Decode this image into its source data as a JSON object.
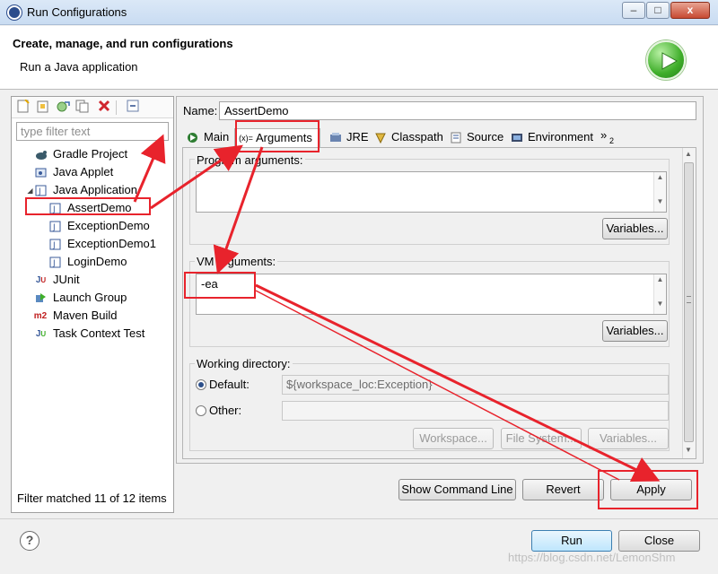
{
  "window": {
    "title": "Run Configurations",
    "controls": {
      "minimize": "–",
      "maximize": "□",
      "close": "x"
    }
  },
  "header": {
    "title": "Create, manage, and run configurations",
    "subtitle": "Run a Java application"
  },
  "left": {
    "toolbar": [
      "new-config-icon",
      "new-prototype-icon",
      "export-icon",
      "duplicate-icon",
      "delete-icon",
      "collapse-all-icon"
    ],
    "filter_placeholder": "type filter text",
    "tree": [
      {
        "label": "Gradle Project",
        "icon": "gradle-icon",
        "level": 0
      },
      {
        "label": "Java Applet",
        "icon": "applet-icon",
        "level": 0
      },
      {
        "label": "Java Application",
        "icon": "java-app-icon",
        "level": 0,
        "expanded": true
      },
      {
        "label": "AssertDemo",
        "icon": "java-class-icon",
        "level": 1,
        "selected": true
      },
      {
        "label": "ExceptionDemo",
        "icon": "java-class-icon",
        "level": 1
      },
      {
        "label": "ExceptionDemo1",
        "icon": "java-class-icon",
        "level": 1
      },
      {
        "label": "LoginDemo",
        "icon": "java-class-icon",
        "level": 1
      },
      {
        "label": "JUnit",
        "icon": "junit-icon",
        "level": 0
      },
      {
        "label": "Launch Group",
        "icon": "launch-group-icon",
        "level": 0
      },
      {
        "label": "Maven Build",
        "icon": "maven-icon",
        "level": 0
      },
      {
        "label": "Task Context Test",
        "icon": "task-context-icon",
        "level": 0
      }
    ],
    "status": "Filter matched 11 of 12 items"
  },
  "config": {
    "name_label": "Name:",
    "name_value": "AssertDemo",
    "tabs": [
      {
        "label": "Main",
        "icon": "main-icon"
      },
      {
        "label": "Arguments",
        "icon": "arguments-icon",
        "active": true
      },
      {
        "label": "JRE",
        "icon": "jre-icon"
      },
      {
        "label": "Classpath",
        "icon": "classpath-icon"
      },
      {
        "label": "Source",
        "icon": "source-icon"
      },
      {
        "label": "Environment",
        "icon": "environment-icon"
      }
    ],
    "overflow": {
      "chevron": "»",
      "count": "2"
    },
    "program_args": {
      "label": "Program arguments:",
      "value": "",
      "variables_button": "Variables..."
    },
    "vm_args": {
      "label": "VM arguments:",
      "value": "-ea",
      "variables_button": "Variables..."
    },
    "working_dir": {
      "label": "Working directory:",
      "default_label": "Default:",
      "default_value": "${workspace_loc:Exception}",
      "other_label": "Other:",
      "other_value": "",
      "workspace_button": "Workspace...",
      "filesystem_button": "File System...",
      "variables_button": "Variables..."
    },
    "show_command_line_button": "Show Command Line",
    "revert_button": "Revert",
    "apply_button": "Apply"
  },
  "footer": {
    "help": "?",
    "run_button": "Run",
    "close_button": "Close"
  },
  "watermark": "https://blog.csdn.net/LemonShm",
  "colors": {
    "annotation_red": "#e8232c",
    "selection": "#ffffff",
    "run_logo": "#3fae2a"
  }
}
